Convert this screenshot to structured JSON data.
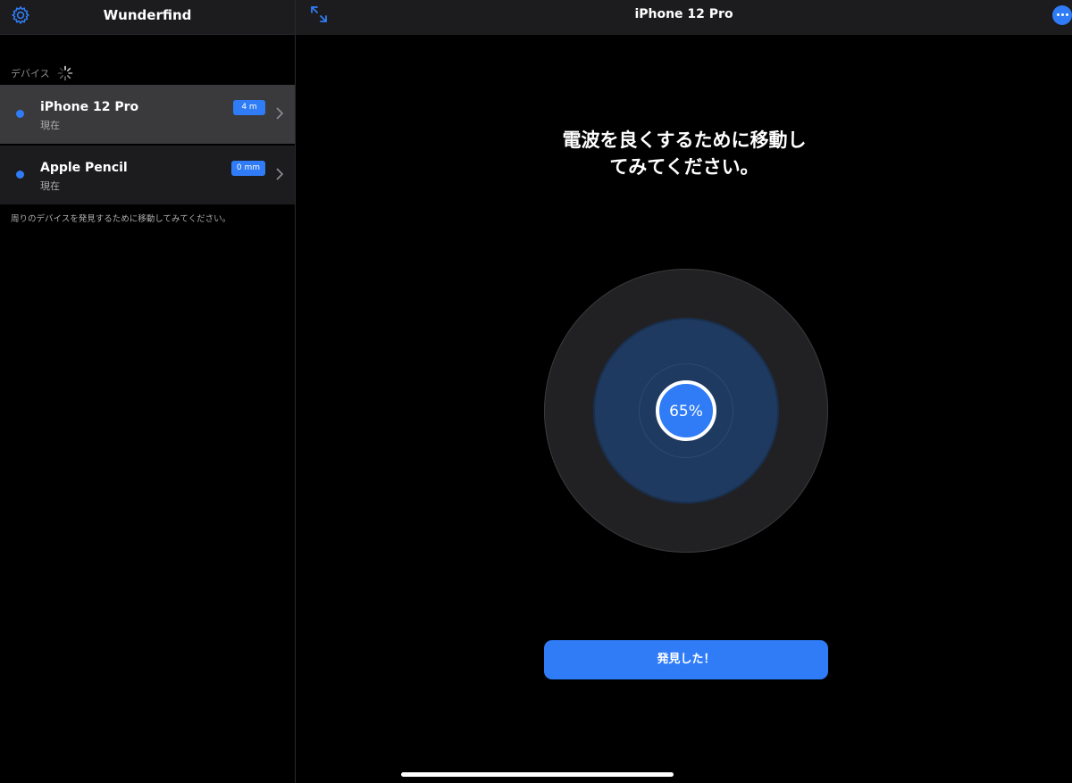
{
  "sidebar": {
    "title": "Wunderfind",
    "section_label": "デバイス",
    "devices": [
      {
        "name": "iPhone 12 Pro",
        "status": "現在",
        "distance": "4 m",
        "selected": true
      },
      {
        "name": "Apple Pencil",
        "status": "現在",
        "distance": "0 mm",
        "selected": false
      }
    ],
    "hint": "周りのデバイスを発見するために移動してみてください。"
  },
  "main": {
    "title": "iPhone 12 Pro",
    "instruction_line1": "電波を良くするために移動し",
    "instruction_line2": "てみてください。",
    "signal_strength": "65%",
    "found_button": "発見した！"
  },
  "colors": {
    "accent": "#2f7cf6",
    "background": "#000000",
    "header": "#1c1c1e",
    "selected_row": "#3a3a3c"
  },
  "icons": {
    "settings": "gear-icon",
    "expand": "expand-icon",
    "more": "ellipsis-circle-icon",
    "loading": "spinner-icon",
    "disclosure": "chevron-right-icon"
  }
}
